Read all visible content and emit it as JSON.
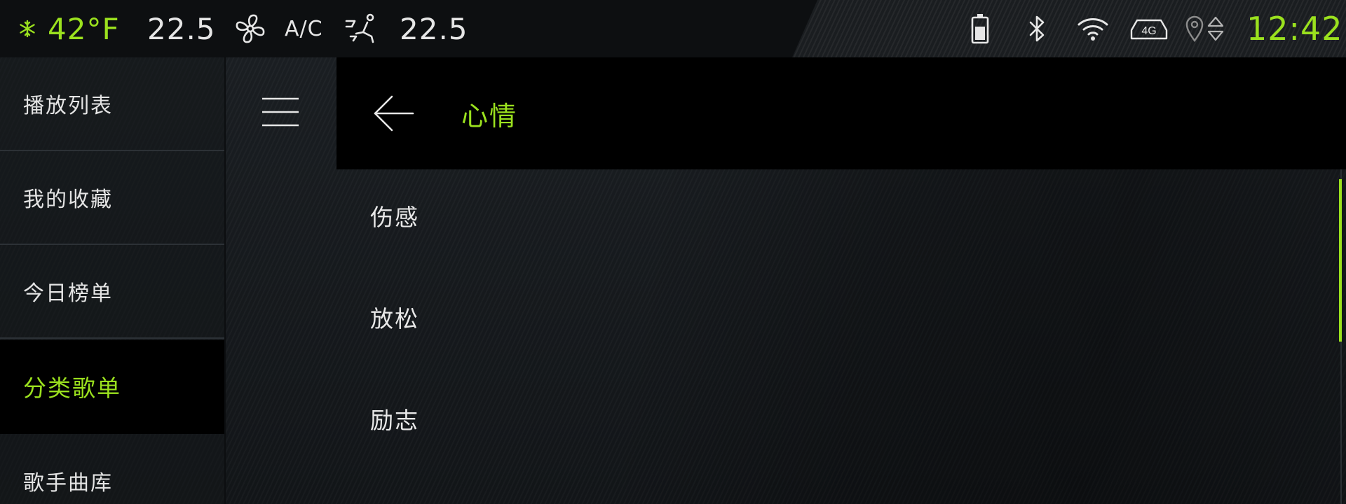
{
  "status_bar": {
    "outside_temp": "42°F",
    "driver_temp": "22.5",
    "ac_label": "A/C",
    "passenger_temp": "22.5",
    "clock": "12:42",
    "network_label": "4G",
    "icons": [
      "snowflake-icon",
      "fan-icon",
      "seat-airflow-icon",
      "battery-icon",
      "bluetooth-icon",
      "wifi-icon",
      "network-4g-icon",
      "location-icon",
      "navigation-arrows-icon"
    ]
  },
  "sidebar": {
    "items": [
      {
        "label": "播放列表"
      },
      {
        "label": "我的收藏"
      },
      {
        "label": "今日榜单"
      },
      {
        "label": "分类歌单",
        "active": true
      },
      {
        "label": "歌手曲库"
      }
    ]
  },
  "header": {
    "title": "心情"
  },
  "list": {
    "items": [
      {
        "label": "伤感"
      },
      {
        "label": "放松"
      },
      {
        "label": "励志"
      }
    ]
  },
  "colors": {
    "accent": "#9be11e",
    "text": "#e6e6e6",
    "background": "#14171a",
    "header_bg": "#000000"
  }
}
